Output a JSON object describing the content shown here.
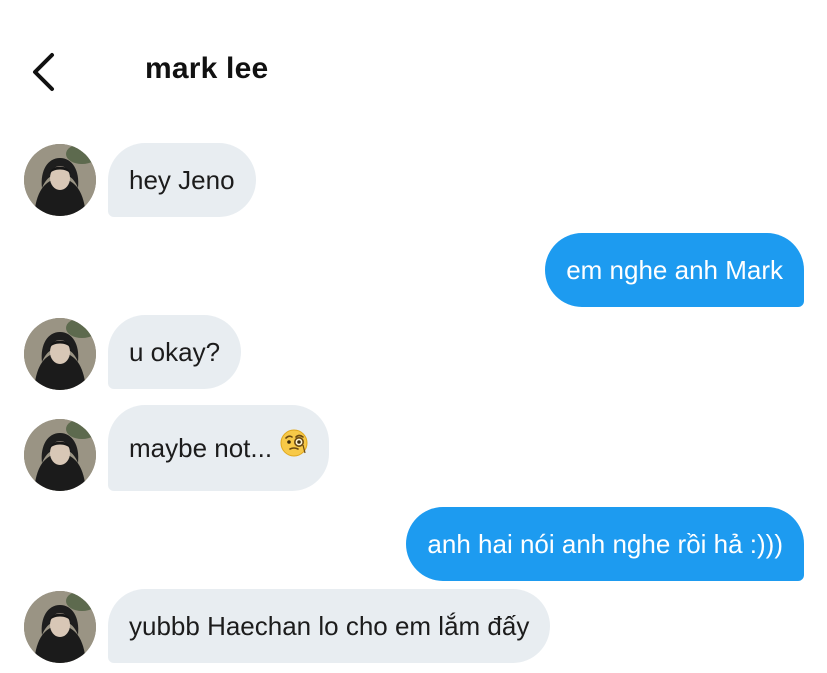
{
  "header": {
    "back_icon": "chevron-left-icon",
    "title": "mark lee"
  },
  "messages": [
    {
      "from": "them",
      "text": "hey Jeno"
    },
    {
      "from": "me",
      "text": "em nghe anh Mark"
    },
    {
      "from": "them",
      "text": "u okay?"
    },
    {
      "from": "them",
      "text": "maybe not...",
      "emoji": "face-with-monocle-icon"
    },
    {
      "from": "me",
      "text": "anh hai nói anh nghe rồi hả :)))"
    },
    {
      "from": "them",
      "text": "yubbb Haechan lo cho em lắm đấy"
    }
  ],
  "colors": {
    "incoming_bubble": "#e8edf1",
    "outgoing_bubble": "#1d9bf0",
    "outgoing_text": "#ffffff"
  }
}
